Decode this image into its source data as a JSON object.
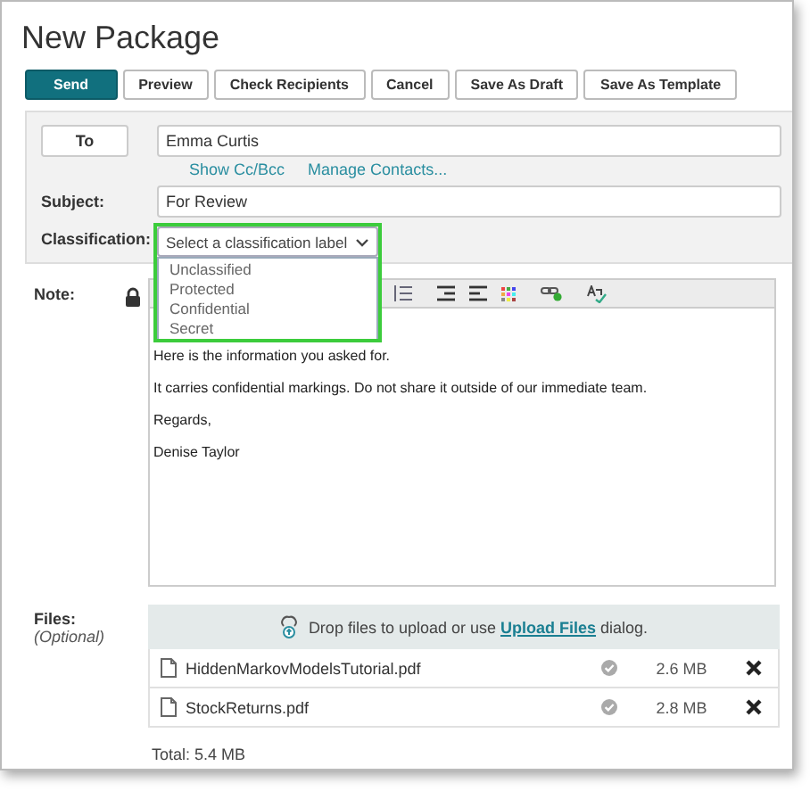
{
  "window": {
    "title": "New Package"
  },
  "buttons": [
    {
      "label": "Send",
      "kind": "primary"
    },
    {
      "label": "Preview",
      "kind": "default"
    },
    {
      "label": "Check Recipients",
      "kind": "default"
    },
    {
      "label": "Cancel",
      "kind": "default"
    },
    {
      "label": "Save As Draft",
      "kind": "default"
    },
    {
      "label": "Save As Template",
      "kind": "default"
    }
  ],
  "to": {
    "button": "To",
    "value": "Emma Curtis",
    "links": [
      "Show Cc/Bcc",
      "Manage Contacts..."
    ]
  },
  "subject": {
    "label": "Subject:",
    "value": "For Review"
  },
  "classification": {
    "label": "Classification:",
    "placeholder": "Select a classification label",
    "expanded": true,
    "options": [
      {
        "label": "Unclassified",
        "selected": false
      },
      {
        "label": "Protected",
        "selected": false
      },
      {
        "label": "Confidential",
        "selected": false
      },
      {
        "label": "Secret",
        "selected": false
      }
    ]
  },
  "note": {
    "label": "Note:",
    "paragraphs": [
      "Here is the information you asked for.",
      "It carries confidential markings. Do not share it outside of our immediate team.",
      "Regards,",
      "Denise Taylor"
    ]
  },
  "files": {
    "label": "Files:",
    "hint": "(Optional)",
    "drop_before": "Drop files to upload or use ",
    "drop_link": "Upload Files",
    "drop_after": " dialog.",
    "items": [
      {
        "name": "HiddenMarkovModelsTutorial.pdf",
        "size": "2.6 MB"
      },
      {
        "name": "StockReturns.pdf",
        "size": "2.8 MB"
      }
    ],
    "total": "Total: 5.4 MB"
  }
}
